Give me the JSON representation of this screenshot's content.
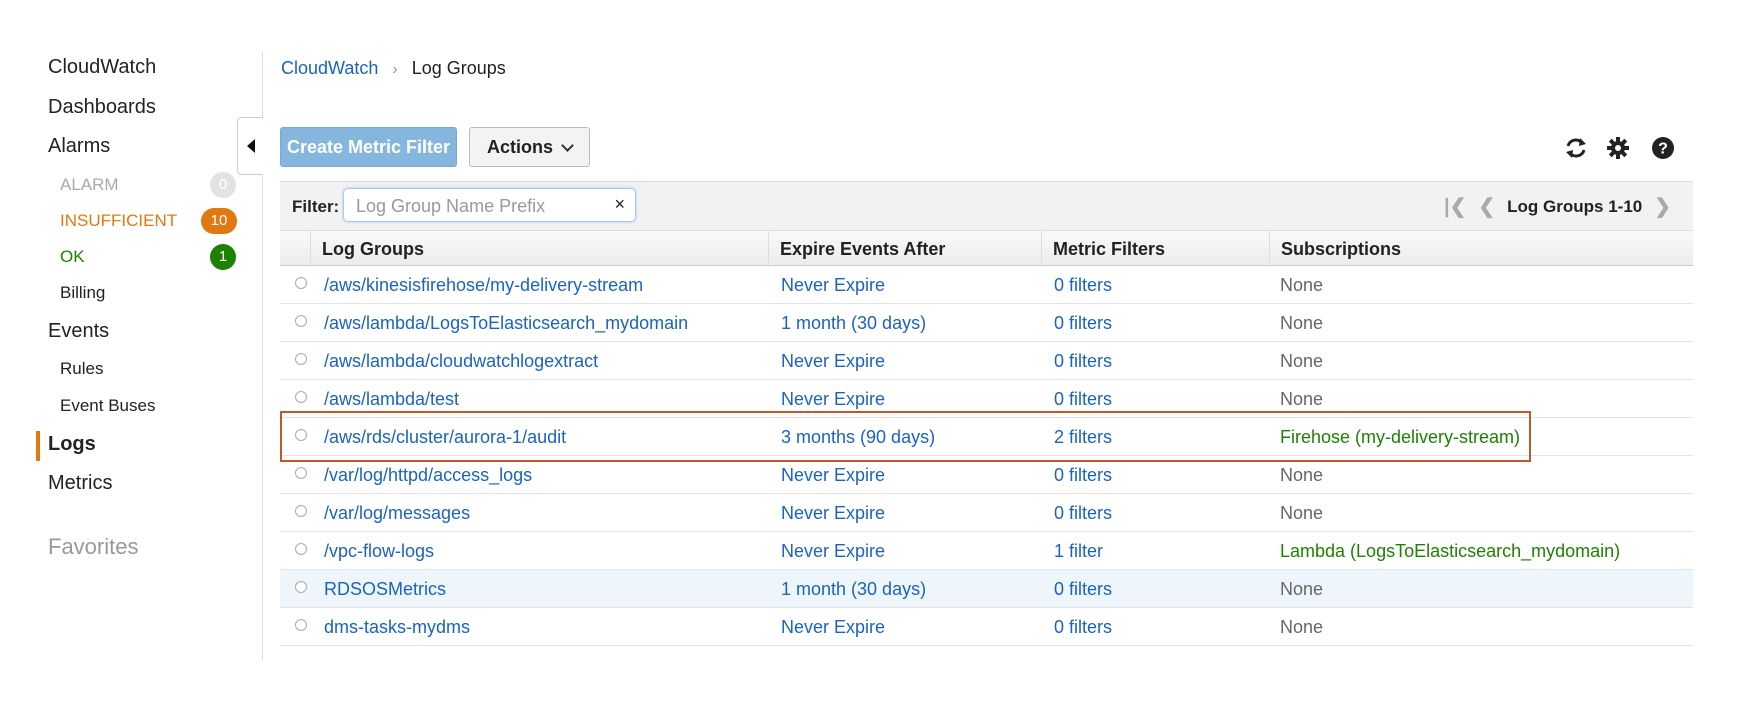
{
  "sidebar": {
    "cloudwatch": "CloudWatch",
    "dashboards": "Dashboards",
    "alarms": "Alarms",
    "alarm_states": [
      {
        "label": "ALARM",
        "count": "0"
      },
      {
        "label": "INSUFFICIENT",
        "count": "10"
      },
      {
        "label": "OK",
        "count": "1"
      }
    ],
    "billing": "Billing",
    "events": "Events",
    "rules": "Rules",
    "event_buses": "Event Buses",
    "logs": "Logs",
    "metrics": "Metrics",
    "favorites": "Favorites",
    "active_item": "Logs"
  },
  "breadcrumb": {
    "root": "CloudWatch",
    "separator": "›",
    "current": "Log Groups"
  },
  "toolbar": {
    "create_label": "Create Metric Filter",
    "actions_label": "Actions",
    "icons": [
      "refresh-icon",
      "gear-icon",
      "help-icon"
    ]
  },
  "filter": {
    "label": "Filter:",
    "placeholder": "Log Group Name Prefix",
    "value": "",
    "clear": "×"
  },
  "pager": {
    "text": "Log Groups 1-10"
  },
  "table": {
    "headers": [
      "Log Groups",
      "Expire Events After",
      "Metric Filters",
      "Subscriptions"
    ],
    "rows": [
      {
        "name": "/aws/kinesisfirehose/my-delivery-stream",
        "expire": "Never Expire",
        "filters": "0 filters",
        "subs": "None"
      },
      {
        "name": "/aws/lambda/LogsToElasticsearch_mydomain",
        "expire": "1 month (30 days)",
        "filters": "0 filters",
        "subs": "None"
      },
      {
        "name": "/aws/lambda/cloudwatchlogextract",
        "expire": "Never Expire",
        "filters": "0 filters",
        "subs": "None"
      },
      {
        "name": "/aws/lambda/test",
        "expire": "Never Expire",
        "filters": "0 filters",
        "subs": "None"
      },
      {
        "name": "/aws/rds/cluster/aurora-1/audit",
        "expire": "3 months (90 days)",
        "filters": "2 filters",
        "subs": "Firehose (my-delivery-stream)"
      },
      {
        "name": "/var/log/httpd/access_logs",
        "expire": "Never Expire",
        "filters": "0 filters",
        "subs": "None"
      },
      {
        "name": "/var/log/messages",
        "expire": "Never Expire",
        "filters": "0 filters",
        "subs": "None"
      },
      {
        "name": "/vpc-flow-logs",
        "expire": "Never Expire",
        "filters": "1 filter",
        "subs": "Lambda (LogsToElasticsearch_mydomain)"
      },
      {
        "name": "RDSOSMetrics",
        "expire": "1 month (30 days)",
        "filters": "0 filters",
        "subs": "None"
      },
      {
        "name": "dms-tasks-mydms",
        "expire": "Never Expire",
        "filters": "0 filters",
        "subs": "None"
      }
    ]
  },
  "colors": {
    "link": "#1a63c0",
    "accent_orange": "#e07a10",
    "ok_green": "#1d8102",
    "primary_button": "#85b6de",
    "highlight_border": "#c0582a"
  }
}
